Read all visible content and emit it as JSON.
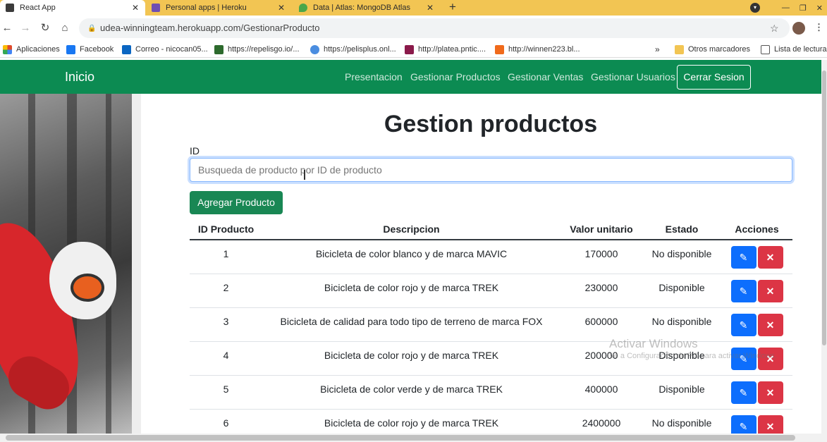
{
  "browser": {
    "tabs": [
      {
        "title": "React App",
        "color": "#3b3b3b"
      },
      {
        "title": "Personal apps | Heroku",
        "color": "#6f4fb1"
      },
      {
        "title": "Data | Atlas: MongoDB Atlas",
        "color": "#4aa74a"
      }
    ],
    "new_tab": "+",
    "url": "udea-winningteam.herokuapp.com/GestionarProducto",
    "bookmarks": [
      {
        "label": "Aplicaciones",
        "color": "#e04a2b"
      },
      {
        "label": "Facebook",
        "color": "#1877f2"
      },
      {
        "label": "Correo - nicocan05...",
        "color": "#0a66c2"
      },
      {
        "label": "https://repelisgo.io/...",
        "color": "#2d6a2d"
      },
      {
        "label": "https://pelisplus.onl...",
        "color": "#4a8de0"
      },
      {
        "label": "http://platea.pntic....",
        "color": "#8a1a4a"
      },
      {
        "label": "http://winnen223.bl...",
        "color": "#f06a1b"
      }
    ],
    "more_bookmarks": "»",
    "other_bookmarks": "Otros marcadores",
    "reading_list": "Lista de lectura"
  },
  "navbar": {
    "brand": "Inicio",
    "links": [
      "Presentacion",
      "Gestionar Productos",
      "Gestionar Ventas",
      "Gestionar Usuarios"
    ],
    "logout": "Cerrar Sesion",
    "bg_color": "#0c8b52"
  },
  "main": {
    "title": "Gestion productos",
    "id_label": "ID",
    "search_placeholder": "Busqueda de producto por ID de producto",
    "add_button": "Agregar Producto",
    "table": {
      "headers": [
        "ID Producto",
        "Descripcion",
        "Valor unitario",
        "Estado",
        "Acciones"
      ],
      "rows": [
        {
          "id": "1",
          "desc": "Bicicleta de color blanco y de marca MAVIC",
          "value": "170000",
          "status": "No disponible"
        },
        {
          "id": "2",
          "desc": "Bicicleta de color rojo y de marca TREK",
          "value": "230000",
          "status": "Disponible"
        },
        {
          "id": "3",
          "desc": "Bicicleta de calidad para todo tipo de terreno de marca FOX",
          "value": "600000",
          "status": "No disponible"
        },
        {
          "id": "4",
          "desc": "Bicicleta de color rojo y de marca TREK",
          "value": "200000",
          "status": "Disponible"
        },
        {
          "id": "5",
          "desc": "Bicicleta de color verde y de marca TREK",
          "value": "400000",
          "status": "Disponible"
        },
        {
          "id": "6",
          "desc": "Bicicleta de color rojo y de marca TREK",
          "value": "2400000",
          "status": "No disponible"
        }
      ],
      "edit_icon": "pencil-icon",
      "delete_icon": "x-icon"
    }
  },
  "watermark": {
    "title": "Activar Windows",
    "subtitle": "Ve a Configuración de PC para activar Windows."
  }
}
